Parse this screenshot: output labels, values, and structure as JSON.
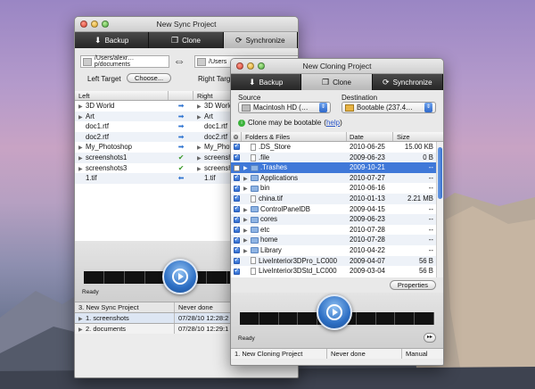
{
  "back_window": {
    "title": "New Sync Project",
    "toolbar": [
      {
        "label": "Backup",
        "icon": "download-icon"
      },
      {
        "label": "Clone",
        "icon": "clone-icon"
      },
      {
        "label": "Synchronize",
        "icon": "sync-icon"
      }
    ],
    "left_path": "/Users/alexr…p/documents",
    "right_path": "/Users",
    "left_target_label": "Left Target",
    "right_target_label": "Right Target",
    "choose_label": "Choose...",
    "columns": {
      "left": "Left",
      "right": "Right"
    },
    "rows": [
      {
        "left": "3D World",
        "right": "3D World",
        "arrow": "right",
        "folder": true
      },
      {
        "left": "Art",
        "right": "Art",
        "arrow": "right",
        "folder": true
      },
      {
        "left": "doc1.rtf",
        "right": "doc1.rtf",
        "arrow": "right",
        "folder": false
      },
      {
        "left": "doc2.rtf",
        "right": "doc2.rtf",
        "arrow": "right",
        "folder": false
      },
      {
        "left": "My_Photoshop",
        "right": "My_Photo",
        "arrow": "right",
        "folder": true
      },
      {
        "left": "screenshots1",
        "right": "screensho",
        "arrow": "check",
        "folder": true
      },
      {
        "left": "screenshots3",
        "right": "screensho",
        "arrow": "check",
        "folder": true
      },
      {
        "left": "1.tif",
        "right": "1.tif",
        "arrow": "left",
        "folder": false
      }
    ],
    "ready_label": "Ready",
    "projects": [
      {
        "name": "3. New Sync Project",
        "status": "Never done"
      },
      {
        "name": "1. screenshots",
        "status": "07/28/10 12:28:2"
      },
      {
        "name": "2. documents",
        "status": "07/28/10 12:29:1"
      }
    ]
  },
  "front_window": {
    "title": "New Cloning Project",
    "toolbar": [
      {
        "label": "Backup",
        "icon": "download-icon"
      },
      {
        "label": "Clone",
        "icon": "clone-icon"
      },
      {
        "label": "Synchronize",
        "icon": "sync-icon"
      }
    ],
    "source_label": "Source",
    "source_value": "Macintosh HD (…",
    "destination_label": "Destination",
    "destination_value": "Bootable (237.4…",
    "bootable_note": "Clone may be bootable",
    "help_link": "help",
    "columns": {
      "files": "Folders & Files",
      "date": "Date",
      "size": "Size"
    },
    "rows": [
      {
        "name": ".DS_Store",
        "date": "2010-06-25",
        "size": "15.00 KB",
        "folder": false,
        "checked": true,
        "expand": false
      },
      {
        "name": ".file",
        "date": "2009-06-23",
        "size": "0 B",
        "folder": false,
        "checked": true,
        "expand": false
      },
      {
        "name": ".Trashes",
        "date": "2009-10-21",
        "size": "--",
        "folder": true,
        "checked": false,
        "expand": true,
        "selected": true
      },
      {
        "name": "Applications",
        "date": "2010-07-27",
        "size": "--",
        "folder": true,
        "checked": true,
        "expand": true
      },
      {
        "name": "bin",
        "date": "2010-06-16",
        "size": "--",
        "folder": true,
        "checked": true,
        "expand": true
      },
      {
        "name": "china.tif",
        "date": "2010-01-13",
        "size": "2.21 MB",
        "folder": false,
        "checked": true,
        "expand": false
      },
      {
        "name": "ControlPanelDB",
        "date": "2009-04-15",
        "size": "--",
        "folder": true,
        "checked": true,
        "expand": true
      },
      {
        "name": "cores",
        "date": "2009-06-23",
        "size": "--",
        "folder": true,
        "checked": true,
        "expand": true
      },
      {
        "name": "etc",
        "date": "2010-07-28",
        "size": "--",
        "folder": true,
        "checked": true,
        "expand": true
      },
      {
        "name": "home",
        "date": "2010-07-28",
        "size": "--",
        "folder": true,
        "checked": true,
        "expand": true
      },
      {
        "name": "Library",
        "date": "2010-04-22",
        "size": "--",
        "folder": true,
        "checked": true,
        "expand": true
      },
      {
        "name": "LiveInterior3DPro_LC000",
        "date": "2009-04-07",
        "size": "56 B",
        "folder": false,
        "checked": true,
        "expand": false
      },
      {
        "name": "LiveInterior3DStd_LC000",
        "date": "2009-03-04",
        "size": "56 B",
        "folder": false,
        "checked": true,
        "expand": false
      }
    ],
    "properties_label": "Properties",
    "ready_label": "Ready",
    "skip_label": "▸▸",
    "status": {
      "project": "1. New Cloning Project",
      "state": "Never done",
      "mode": "Manual"
    }
  }
}
